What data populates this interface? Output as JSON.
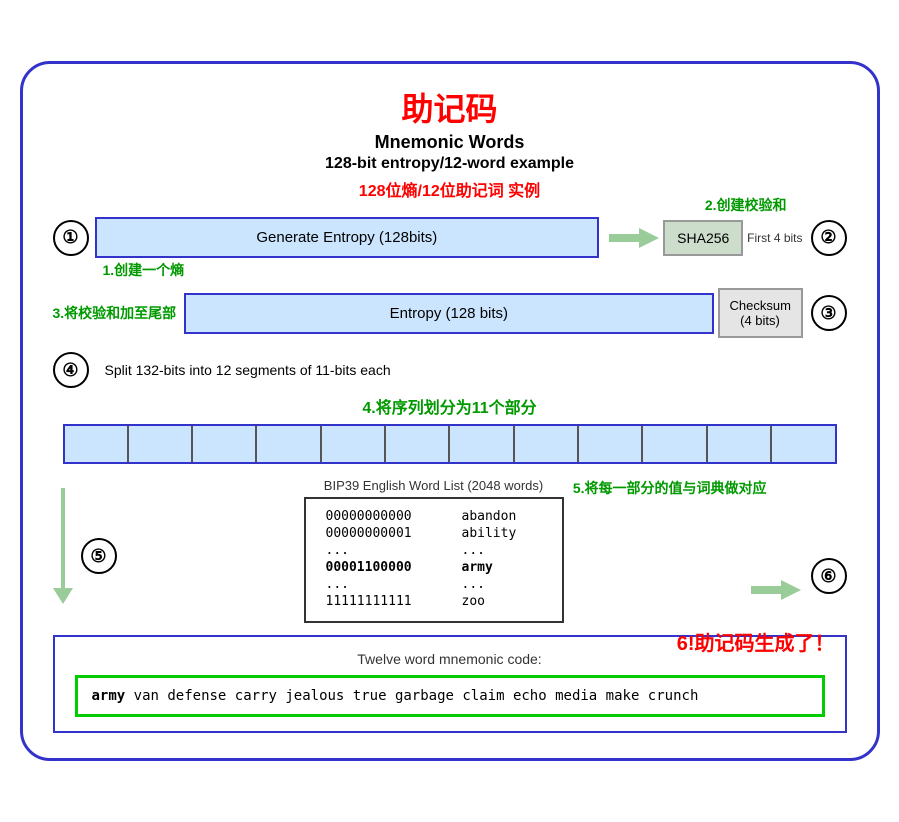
{
  "title": {
    "zh": "助记码",
    "en1": "Mnemonic Words",
    "en2": "128-bit entropy/12-word example",
    "zh2": "128位熵/12位助记词 实例"
  },
  "labels": {
    "label1": "1.创建一个熵",
    "label2": "2.创建校验和",
    "label3": "3.将校验和加至尾部",
    "label4": "4.将序列划分为11个部分",
    "label5": "5.将每一部分的值与词典做对应",
    "label6": "6!助记码生成了！"
  },
  "step1": {
    "circle": "①",
    "box": "Generate Entropy (128bits)",
    "sha": "SHA256",
    "first4": "First 4 bits"
  },
  "step2": {
    "circle": "②"
  },
  "step3": {
    "label": "3.将校验和加至尾部",
    "entropy": "Entropy (128 bits)",
    "checksum": "Checksum\n(4 bits)",
    "circle": "③"
  },
  "step4": {
    "circle": "④",
    "text": "Split 132-bits into 12 segments of 11-bits each"
  },
  "step5": {
    "circle": "⑤",
    "bip39label": "BIP39 English Word List (2048 words)",
    "rows": [
      {
        "bits": "00000000000",
        "word": "abandon"
      },
      {
        "bits": "00000000001",
        "word": "ability"
      },
      {
        "bits": "...",
        "word": "..."
      },
      {
        "bits": "00001100000",
        "word": "army",
        "bold": true
      },
      {
        "bits": "...",
        "word": "..."
      },
      {
        "bits": "11111111111",
        "word": "zoo"
      }
    ]
  },
  "step6": {
    "circle": "⑥",
    "label": "Twelve word mnemonic code:",
    "mnemonic_bold": "army",
    "mnemonic_rest": " van defense carry jealous true\ngarbage claim echo media make crunch"
  }
}
